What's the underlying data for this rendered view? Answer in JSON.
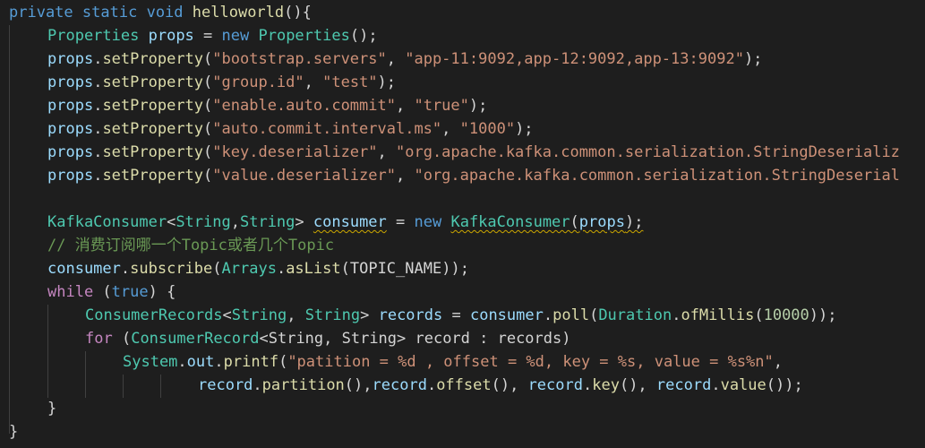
{
  "lines": [
    [
      {
        "t": "private",
        "c": "kw"
      },
      {
        "t": " "
      },
      {
        "t": "static",
        "c": "kw"
      },
      {
        "t": " "
      },
      {
        "t": "void",
        "c": "kw"
      },
      {
        "t": " "
      },
      {
        "t": "helloworld",
        "c": "fn"
      },
      {
        "t": "(){"
      }
    ],
    [
      {
        "t": "Properties",
        "c": "ty"
      },
      {
        "t": " "
      },
      {
        "t": "props",
        "c": "var"
      },
      {
        "t": " = "
      },
      {
        "t": "new",
        "c": "kw"
      },
      {
        "t": " "
      },
      {
        "t": "Properties",
        "c": "ty"
      },
      {
        "t": "();"
      }
    ],
    [
      {
        "t": "props",
        "c": "var"
      },
      {
        "t": "."
      },
      {
        "t": "setProperty",
        "c": "fn"
      },
      {
        "t": "("
      },
      {
        "t": "\"bootstrap.servers\"",
        "c": "str"
      },
      {
        "t": ", "
      },
      {
        "t": "\"app-11:9092,app-12:9092,app-13:9092\"",
        "c": "str"
      },
      {
        "t": ");"
      }
    ],
    [
      {
        "t": "props",
        "c": "var"
      },
      {
        "t": "."
      },
      {
        "t": "setProperty",
        "c": "fn"
      },
      {
        "t": "("
      },
      {
        "t": "\"group.id\"",
        "c": "str"
      },
      {
        "t": ", "
      },
      {
        "t": "\"test\"",
        "c": "str"
      },
      {
        "t": ");"
      }
    ],
    [
      {
        "t": "props",
        "c": "var"
      },
      {
        "t": "."
      },
      {
        "t": "setProperty",
        "c": "fn"
      },
      {
        "t": "("
      },
      {
        "t": "\"enable.auto.commit\"",
        "c": "str"
      },
      {
        "t": ", "
      },
      {
        "t": "\"true\"",
        "c": "str"
      },
      {
        "t": ");"
      }
    ],
    [
      {
        "t": "props",
        "c": "var"
      },
      {
        "t": "."
      },
      {
        "t": "setProperty",
        "c": "fn"
      },
      {
        "t": "("
      },
      {
        "t": "\"auto.commit.interval.ms\"",
        "c": "str"
      },
      {
        "t": ", "
      },
      {
        "t": "\"1000\"",
        "c": "str"
      },
      {
        "t": ");"
      }
    ],
    [
      {
        "t": "props",
        "c": "var"
      },
      {
        "t": "."
      },
      {
        "t": "setProperty",
        "c": "fn"
      },
      {
        "t": "("
      },
      {
        "t": "\"key.deserializer\"",
        "c": "str"
      },
      {
        "t": ", "
      },
      {
        "t": "\"org.apache.kafka.common.serialization.StringDeserializ",
        "c": "str"
      }
    ],
    [
      {
        "t": "props",
        "c": "var"
      },
      {
        "t": "."
      },
      {
        "t": "setProperty",
        "c": "fn"
      },
      {
        "t": "("
      },
      {
        "t": "\"value.deserializer\"",
        "c": "str"
      },
      {
        "t": ", "
      },
      {
        "t": "\"org.apache.kafka.common.serialization.StringDeserial",
        "c": "str"
      }
    ],
    [],
    [
      {
        "t": "KafkaConsumer",
        "c": "ty"
      },
      {
        "t": "<"
      },
      {
        "t": "String",
        "c": "ty"
      },
      {
        "t": ","
      },
      {
        "t": "String",
        "c": "ty"
      },
      {
        "t": "> "
      },
      {
        "t": "consumer",
        "c": "var",
        "u": true
      },
      {
        "t": " = "
      },
      {
        "t": "new",
        "c": "kw"
      },
      {
        "t": " "
      },
      {
        "t": "KafkaConsumer",
        "c": "ty",
        "u": true
      },
      {
        "t": "(",
        "u": true
      },
      {
        "t": "props",
        "c": "var",
        "u": true
      },
      {
        "t": ");",
        "u": true
      }
    ],
    [
      {
        "t": "// 消费订阅哪一个Topic或者几个Topic",
        "c": "cm"
      }
    ],
    [
      {
        "t": "consumer",
        "c": "var"
      },
      {
        "t": "."
      },
      {
        "t": "subscribe",
        "c": "fn"
      },
      {
        "t": "("
      },
      {
        "t": "Arrays",
        "c": "ty"
      },
      {
        "t": "."
      },
      {
        "t": "asList",
        "c": "fn"
      },
      {
        "t": "("
      },
      {
        "t": "TOPIC_NAME"
      },
      {
        "t": "));"
      }
    ],
    [
      {
        "t": "while",
        "c": "ctl"
      },
      {
        "t": " ("
      },
      {
        "t": "true",
        "c": "kw"
      },
      {
        "t": ") {"
      }
    ],
    [
      {
        "t": "ConsumerRecords",
        "c": "ty"
      },
      {
        "t": "<"
      },
      {
        "t": "String",
        "c": "ty"
      },
      {
        "t": ", "
      },
      {
        "t": "String",
        "c": "ty"
      },
      {
        "t": "> "
      },
      {
        "t": "records",
        "c": "var"
      },
      {
        "t": " = "
      },
      {
        "t": "consumer",
        "c": "var"
      },
      {
        "t": "."
      },
      {
        "t": "poll",
        "c": "fn"
      },
      {
        "t": "("
      },
      {
        "t": "Duration",
        "c": "ty"
      },
      {
        "t": "."
      },
      {
        "t": "ofMillis",
        "c": "fn"
      },
      {
        "t": "("
      },
      {
        "t": "10000",
        "c": "num"
      },
      {
        "t": "));"
      }
    ],
    [
      {
        "t": "for",
        "c": "ctl"
      },
      {
        "t": " ("
      },
      {
        "t": "ConsumerRecord",
        "c": "ty"
      },
      {
        "t": "<String, String> record : records)"
      }
    ],
    [
      {
        "t": "System",
        "c": "ty"
      },
      {
        "t": "."
      },
      {
        "t": "out",
        "c": "var"
      },
      {
        "t": "."
      },
      {
        "t": "printf",
        "c": "fn"
      },
      {
        "t": "("
      },
      {
        "t": "\"patition = %d , offset = %d, key = %s, value = %s%n\"",
        "c": "str"
      },
      {
        "t": ","
      }
    ],
    [
      {
        "t": "record",
        "c": "var"
      },
      {
        "t": "."
      },
      {
        "t": "partition",
        "c": "fn"
      },
      {
        "t": "(),"
      },
      {
        "t": "record",
        "c": "var"
      },
      {
        "t": "."
      },
      {
        "t": "offset",
        "c": "fn"
      },
      {
        "t": "(), "
      },
      {
        "t": "record",
        "c": "var"
      },
      {
        "t": "."
      },
      {
        "t": "key",
        "c": "fn"
      },
      {
        "t": "(), "
      },
      {
        "t": "record",
        "c": "var"
      },
      {
        "t": "."
      },
      {
        "t": "value",
        "c": "fn"
      },
      {
        "t": "());"
      }
    ],
    [
      {
        "t": "}"
      }
    ],
    [
      {
        "t": "}"
      }
    ]
  ]
}
